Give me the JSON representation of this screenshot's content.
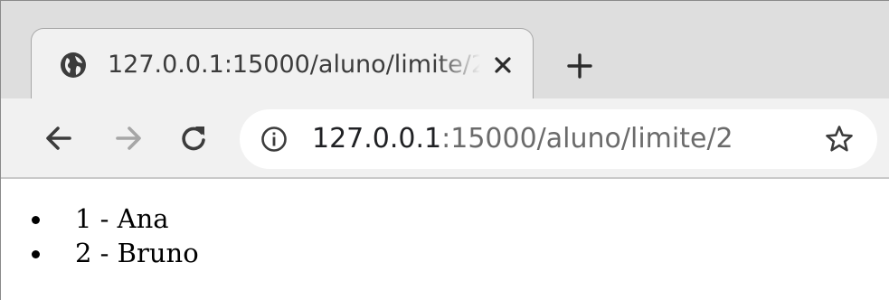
{
  "tab": {
    "title": "127.0.0.1:15000/aluno/limite/2",
    "icon": "globe-icon",
    "close_icon": "close-icon"
  },
  "new_tab_icon": "plus-icon",
  "toolbar": {
    "back_icon": "arrow-left-icon",
    "forward_icon": "arrow-right-icon",
    "reload_icon": "reload-icon",
    "site_info_icon": "info-icon",
    "bookmark_icon": "star-icon",
    "url_host": "127.0.0.1",
    "url_rest": ":15000/aluno/limite/2"
  },
  "page": {
    "items": [
      {
        "text": "1 - Ana"
      },
      {
        "text": "2 - Bruno"
      }
    ]
  }
}
